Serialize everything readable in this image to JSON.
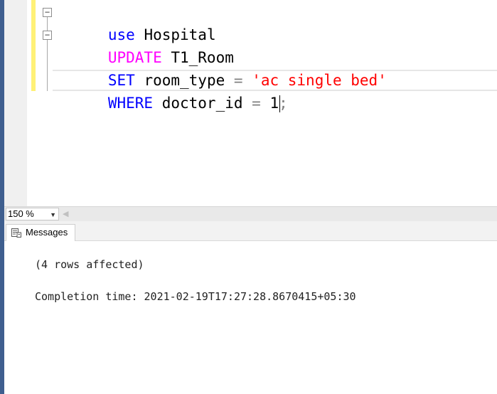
{
  "editor": {
    "lines": [
      {
        "tokens": [
          {
            "text": "use",
            "style": "kw-blue"
          },
          {
            "text": " Hospital",
            "style": ""
          }
        ]
      },
      {
        "tokens": [
          {
            "text": "UPDATE",
            "style": "kw-pink"
          },
          {
            "text": " T1_Room",
            "style": ""
          }
        ]
      },
      {
        "tokens": [
          {
            "text": "SET",
            "style": "kw-blue"
          },
          {
            "text": " room_type ",
            "style": ""
          },
          {
            "text": "=",
            "style": "op-gray"
          },
          {
            "text": " ",
            "style": ""
          },
          {
            "text": "'ac single bed'",
            "style": "str-red"
          }
        ]
      },
      {
        "tokens": [
          {
            "text": "WHERE",
            "style": "kw-blue"
          },
          {
            "text": " doctor_id ",
            "style": ""
          },
          {
            "text": "=",
            "style": "op-gray"
          },
          {
            "text": " 1",
            "style": ""
          },
          {
            "text": ";",
            "style": "op-gray"
          }
        ]
      }
    ],
    "collapse_symbol": "−"
  },
  "zoom": {
    "value": "150 %",
    "arrow": "▼",
    "scroll_left_arrow": "◀"
  },
  "tabs": [
    {
      "label": "Messages",
      "icon": "messages-icon"
    }
  ],
  "messages": {
    "rows_affected": "(4 rows affected)",
    "completion": "Completion time: 2021-02-19T17:27:28.8670415+05:30"
  },
  "colors": {
    "keyword_blue": "#0000ff",
    "keyword_pink": "#ff00ff",
    "string_red": "#ff0000",
    "operator_gray": "#808080",
    "change_bar_yellow": "#fff176",
    "window_edge": "#3f5f8f"
  }
}
